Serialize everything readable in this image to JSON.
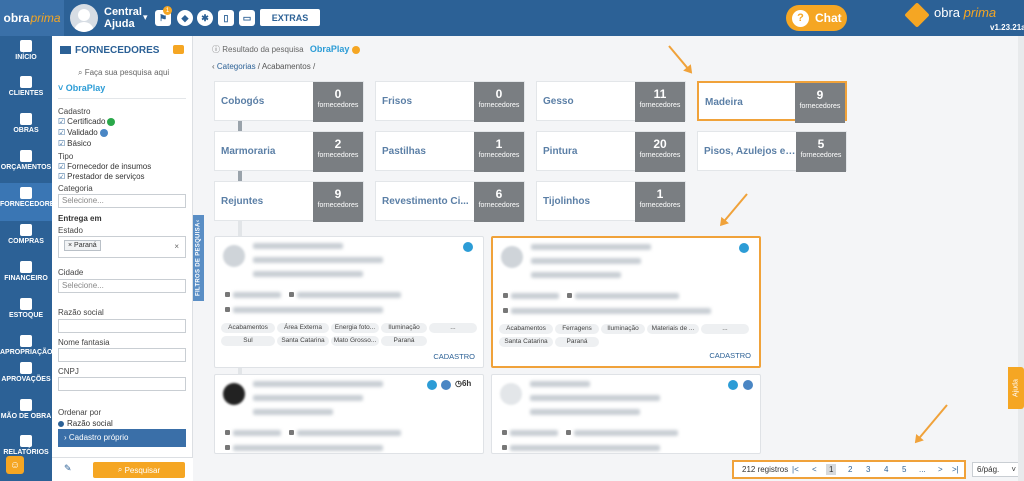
{
  "header": {
    "logo_part1": "obra",
    "logo_part2": "prima",
    "user_name": "Central Ajuda",
    "notif_count": "1",
    "extras_label": "EXTRAS",
    "chat_label": "Chat",
    "brand_part1": "obra",
    "brand_part2": "prima",
    "version": "v1.23.21a"
  },
  "nav": [
    {
      "label": "INÍCIO"
    },
    {
      "label": "CLIENTES"
    },
    {
      "label": "OBRAS"
    },
    {
      "label": "ORÇAMENTOS"
    },
    {
      "label": "FORNECEDORES"
    },
    {
      "label": "COMPRAS"
    },
    {
      "label": "FINANCEIRO"
    },
    {
      "label": "ESTOQUE"
    },
    {
      "label": "APROPRIAÇÃO"
    },
    {
      "label": "APROVAÇÕES"
    },
    {
      "label": "MÃO DE OBRA"
    },
    {
      "label": "RELATÓRIOS"
    }
  ],
  "filter": {
    "title": "FORNECEDORES",
    "search_hint": "Faça sua pesquisa aqui",
    "obraplay": "ObraPlay",
    "cadastro_label": "Cadastro",
    "cadastro_opts": [
      "Certificado",
      "Validado",
      "Básico"
    ],
    "tipo_label": "Tipo",
    "tipo_opts": [
      "Fornecedor de insumos",
      "Prestador de serviços"
    ],
    "categoria_label": "Categoria",
    "categoria_placeholder": "Selecione...",
    "entrega_label": "Entrega em",
    "estado_label": "Estado",
    "estado_tag": "Paraná",
    "cidade_label": "Cidade",
    "cidade_placeholder": "Selecione...",
    "razao_label": "Razão social",
    "fantasia_label": "Nome fantasia",
    "cnpj_label": "CNPJ",
    "ordenar_label": "Ordenar por",
    "ordenar_opt": "Razão social",
    "cadastro_proprio": "Cadastro próprio",
    "search_button": "Pesquisar",
    "collapse_tab": "FILTROS DE PESQUISA"
  },
  "main": {
    "result_label": "Resultado da pesquisa",
    "result_op": "ObraPlay",
    "breadcrumb_cat": "Categorias",
    "breadcrumb_rest": "Acabamentos /",
    "count_label": "fornecedores",
    "categories": [
      {
        "name": "Cobogós",
        "count": "0"
      },
      {
        "name": "Frisos",
        "count": "0"
      },
      {
        "name": "Gesso",
        "count": "11"
      },
      {
        "name": "Madeira",
        "count": "9"
      },
      {
        "name": "Marmoraria",
        "count": "2"
      },
      {
        "name": "Pastilhas",
        "count": "1"
      },
      {
        "name": "Pintura",
        "count": "20"
      },
      {
        "name": "Pisos, Azulejos e ...",
        "count": "5"
      },
      {
        "name": "Rejuntes",
        "count": "9"
      },
      {
        "name": "Revestimento Ci...",
        "count": "6"
      },
      {
        "name": "Tijolinhos",
        "count": "1"
      }
    ],
    "card1_chips": [
      "Acabamentos",
      "Área Externa",
      "Energia foto...",
      "Iluminação",
      "...",
      "Sul",
      "Santa Catarina",
      "Mato Grosso...",
      "Paraná"
    ],
    "card2_chips": [
      "Acabamentos",
      "Ferragens",
      "Iluminação",
      "Materiais de ...",
      "...",
      "Santa Catarina",
      "Paraná"
    ],
    "card_cadastro": "CADASTRO",
    "card3_hours": "6h"
  },
  "pager": {
    "records": "212 registros",
    "first": "|<",
    "prev": "<",
    "pages": [
      "1",
      "2",
      "3",
      "4",
      "5"
    ],
    "ellipsis": "...",
    "next": ">",
    "last": ">|",
    "per_page": "6/pág."
  },
  "ajuda_label": "Ajuda"
}
